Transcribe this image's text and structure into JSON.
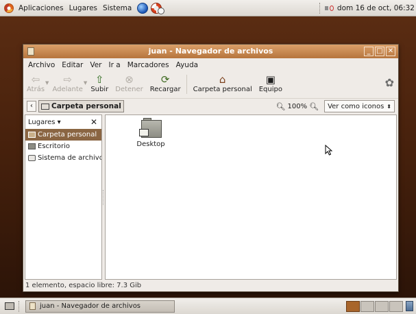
{
  "top_panel": {
    "menus": [
      "Aplicaciones",
      "Lugares",
      "Sistema"
    ],
    "clock": "dom 16 de oct, 06:32"
  },
  "window": {
    "title": "juan - Navegador de archivos",
    "menubar": [
      {
        "label": "Archivo",
        "ul": "A"
      },
      {
        "label": "Editar",
        "ul": "E"
      },
      {
        "label": "Ver",
        "ul": "V"
      },
      {
        "label": "Ir a",
        "ul": "I"
      },
      {
        "label": "Marcadores",
        "ul": "M"
      },
      {
        "label": "Ayuda",
        "ul": "y"
      }
    ],
    "toolbar": {
      "back": "Atrás",
      "forward": "Adelante",
      "up": "Subir",
      "stop": "Detener",
      "reload": "Recargar",
      "home": "Carpeta personal",
      "computer": "Equipo"
    },
    "location": {
      "path_button": "Carpeta personal",
      "zoom": "100%",
      "view_mode": "Ver como iconos"
    },
    "sidepane": {
      "header": "Lugares",
      "items": [
        "Carpeta personal",
        "Escritorio",
        "Sistema de archivo"
      ],
      "selected_index": 0
    },
    "files": [
      {
        "name": "Desktop"
      }
    ],
    "status": "1 elemento, espacio libre: 7.3 Gib"
  },
  "bottom_panel": {
    "task_title": "juan - Navegador de archivos"
  },
  "colors": {
    "titlebar": "#c88a52",
    "selection": "#8a6542",
    "desktop": "#45200c"
  }
}
